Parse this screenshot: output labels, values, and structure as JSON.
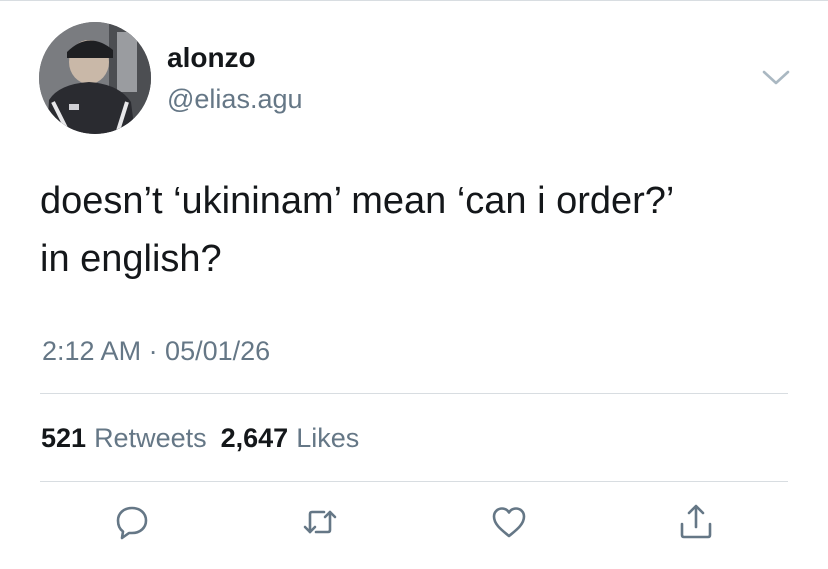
{
  "author": {
    "display_name": "alonzo",
    "handle": "@elias.agu"
  },
  "tweet": {
    "text_lines": [
      "doesn’t ‘ukininam’ mean ‘can i order?’",
      "in english?"
    ],
    "timestamp": "2:12 AM · 05/01/26"
  },
  "stats": {
    "retweets_count": "521",
    "retweets_label": "Retweets",
    "likes_count": "2,647",
    "likes_label": "Likes"
  },
  "actions": {
    "reply_icon": "reply-icon",
    "retweet_icon": "retweet-icon",
    "like_icon": "heart-icon",
    "share_icon": "share-icon"
  },
  "colors": {
    "text": "#14171a",
    "secondary": "#657786",
    "divider": "#d8dde1"
  }
}
